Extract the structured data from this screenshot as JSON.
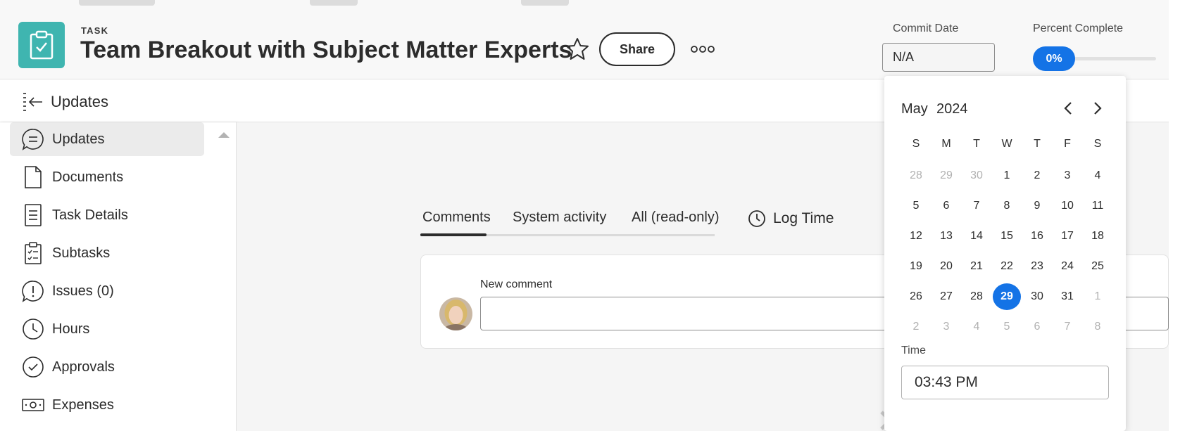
{
  "header": {
    "object_type": "TASK",
    "title": "Team Breakout with Subject Matter Experts",
    "share_label": "Share",
    "commit_date_label": "Commit Date",
    "commit_date_value": "N/A",
    "percent_complete_label": "Percent Complete",
    "percent_complete_value": "0%",
    "percent_complete_fraction": 0
  },
  "updates_bar": {
    "label": "Updates"
  },
  "sidebar": {
    "items": [
      {
        "label": "Updates",
        "icon": "speech-bubble-icon",
        "active": true
      },
      {
        "label": "Documents",
        "icon": "document-icon"
      },
      {
        "label": "Task Details",
        "icon": "task-details-icon"
      },
      {
        "label": "Subtasks",
        "icon": "subtasks-icon"
      },
      {
        "label": "Issues (0)",
        "icon": "issue-icon"
      },
      {
        "label": "Hours",
        "icon": "clock-icon"
      },
      {
        "label": "Approvals",
        "icon": "check-circle-icon"
      },
      {
        "label": "Expenses",
        "icon": "money-icon"
      }
    ]
  },
  "main": {
    "tabs": [
      {
        "label": "Comments",
        "active": true
      },
      {
        "label": "System activity"
      },
      {
        "label": "All (read-only)"
      }
    ],
    "log_time_label": "Log Time",
    "new_comment_label": "New comment"
  },
  "calendar": {
    "month": "May",
    "year": "2024",
    "weekdays": [
      "S",
      "M",
      "T",
      "W",
      "T",
      "F",
      "S"
    ],
    "weeks": [
      [
        "28",
        "29",
        "30",
        "1",
        "2",
        "3",
        "4"
      ],
      [
        "5",
        "6",
        "7",
        "8",
        "9",
        "10",
        "11"
      ],
      [
        "12",
        "13",
        "14",
        "15",
        "16",
        "17",
        "18"
      ],
      [
        "19",
        "20",
        "21",
        "22",
        "23",
        "24",
        "25"
      ],
      [
        "26",
        "27",
        "28",
        "29",
        "30",
        "31",
        "1"
      ],
      [
        "2",
        "3",
        "4",
        "5",
        "6",
        "7",
        "8"
      ]
    ],
    "selected_day": "29",
    "time_label": "Time",
    "time_value": "03:43 PM"
  },
  "colors": {
    "accent": "#1473e6",
    "task_icon_bg": "#3fb5b0"
  }
}
